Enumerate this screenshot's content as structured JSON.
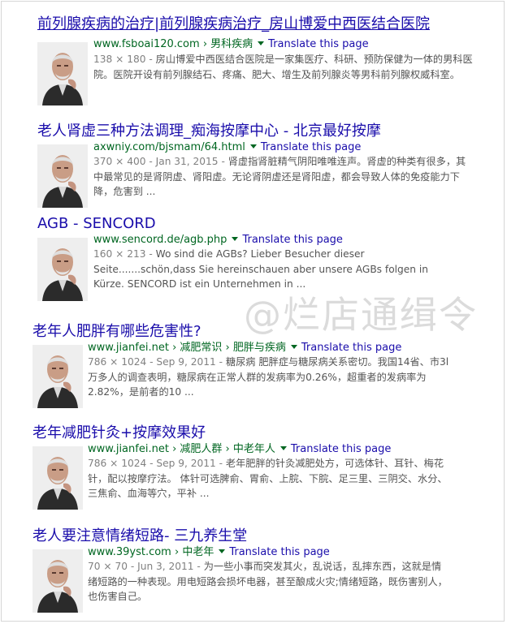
{
  "watermark": "@烂店通缉令",
  "results": [
    {
      "title": "前列腺疾病的治疗|前列腺疾病治疗_房山博爱中西医结合医院",
      "url": "www.fsboai120.com",
      "breadcrumb": "› 男科疾病",
      "translate": "Translate this page",
      "meta": "138 × 180 - ",
      "snippet": "房山博爱中西医结合医院是一家集医疗、科研、预防保健为一体的男科医院。医院开设有前列腺结石、疼痛、肥大、增生及前列腺炎等男科前列腺权威科室。"
    },
    {
      "title": "老人肾虚三种方法调理_痴海按摩中心 - 北京最好按摩",
      "url": "axwniy.com/bjsmam/64.html",
      "breadcrumb": "",
      "translate": "Translate this page",
      "meta": "370 × 400 - Jan 31, 2015 - ",
      "snippet": "肾虚指肾脏精气阴阳唯唯连声。肾虚的种类有很多，其中最常见的是肾阴虚、肾阳虚。无论肾阴虚还是肾阳虚，都会导致人体的免疫能力下降，危害到 ..."
    },
    {
      "title": "AGB - SENCORD",
      "url": "www.sencord.de/agb.php",
      "breadcrumb": "",
      "translate": "Translate this page",
      "meta": "160 × 213 - ",
      "snippet": "Wo sind die AGBs? Lieber Besucher dieser Seite.......schön,dass Sie hereinschauen aber unsere AGBs folgen in Kürze. SENCORD ist ein Unternehmen in ..."
    },
    {
      "title": "老年人肥胖有哪些危害性?",
      "url": "www.jianfei.net",
      "breadcrumb": "› 减肥常识 › 肥胖与疾病",
      "translate": "Translate this page",
      "meta": "786 × 1024 - Sep 9, 2011 - ",
      "snippet": "糖尿病 肥胖症与糖尿病关系密切。我国14省、市3l万多人的调查表明，糖尿病在正常人群的发病率为0.26%，超重者的发病率为2.82%，是前者的10 ..."
    },
    {
      "title": "老年减肥针灸+按摩效果好",
      "url": "www.jianfei.net",
      "breadcrumb": "› 减肥人群 › 中老年人",
      "translate": "Translate this page",
      "meta": "786 × 1024 - Sep 9, 2011 - ",
      "snippet": "老年肥胖的针灸减肥处方，可选体针、耳针、梅花针，配以按摩疗法。 体针可选脾俞、胃俞、上脘、下脘、足三里、三阴交、水分、三焦俞、血海等穴，平补 ..."
    },
    {
      "title": "老人要注意情绪短路- 三九养生堂",
      "url": "www.39yst.com",
      "breadcrumb": "› 中老年",
      "translate": "Translate this page",
      "meta": "70 × 70 - Jun 3, 2011 - ",
      "snippet": "为一些小事而突发其火，乱说话，乱摔东西，这就是情绪短路的一种表现。用电短路会损坏电器，甚至酿成火灾;情绪短路，既伤害别人，也伤害自己。"
    }
  ]
}
